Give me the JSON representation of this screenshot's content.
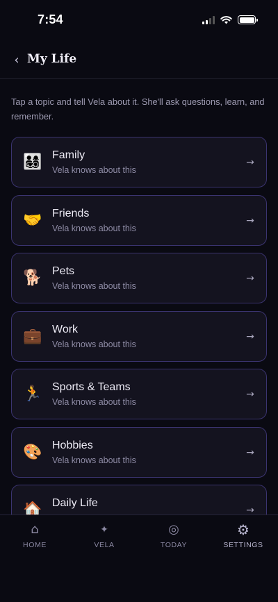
{
  "status_bar": {
    "time": "7:54"
  },
  "header": {
    "back_icon": "‹",
    "title": "My Life"
  },
  "intro": "Tap a topic and tell Vela about it. She'll ask questions, learn, and remember.",
  "topics": [
    {
      "emoji": "👨‍👩‍👧‍👦",
      "title": "Family",
      "subtitle": "Vela knows about this"
    },
    {
      "emoji": "🤝",
      "title": "Friends",
      "subtitle": "Vela knows about this"
    },
    {
      "emoji": "🐕",
      "title": "Pets",
      "subtitle": "Vela knows about this"
    },
    {
      "emoji": "💼",
      "title": "Work",
      "subtitle": "Vela knows about this"
    },
    {
      "emoji": "🏃",
      "title": "Sports & Teams",
      "subtitle": "Vela knows about this"
    },
    {
      "emoji": "🎨",
      "title": "Hobbies",
      "subtitle": "Vela knows about this"
    },
    {
      "emoji": "🏠",
      "title": "Daily Life",
      "subtitle": ""
    }
  ],
  "arrow_glyph": "→",
  "tabs": [
    {
      "icon": "⌂",
      "label": "HOME"
    },
    {
      "icon": "✦",
      "label": "VELA"
    },
    {
      "icon": "◎",
      "label": "TODAY"
    },
    {
      "icon": "⚙",
      "label": "SETTINGS"
    }
  ]
}
